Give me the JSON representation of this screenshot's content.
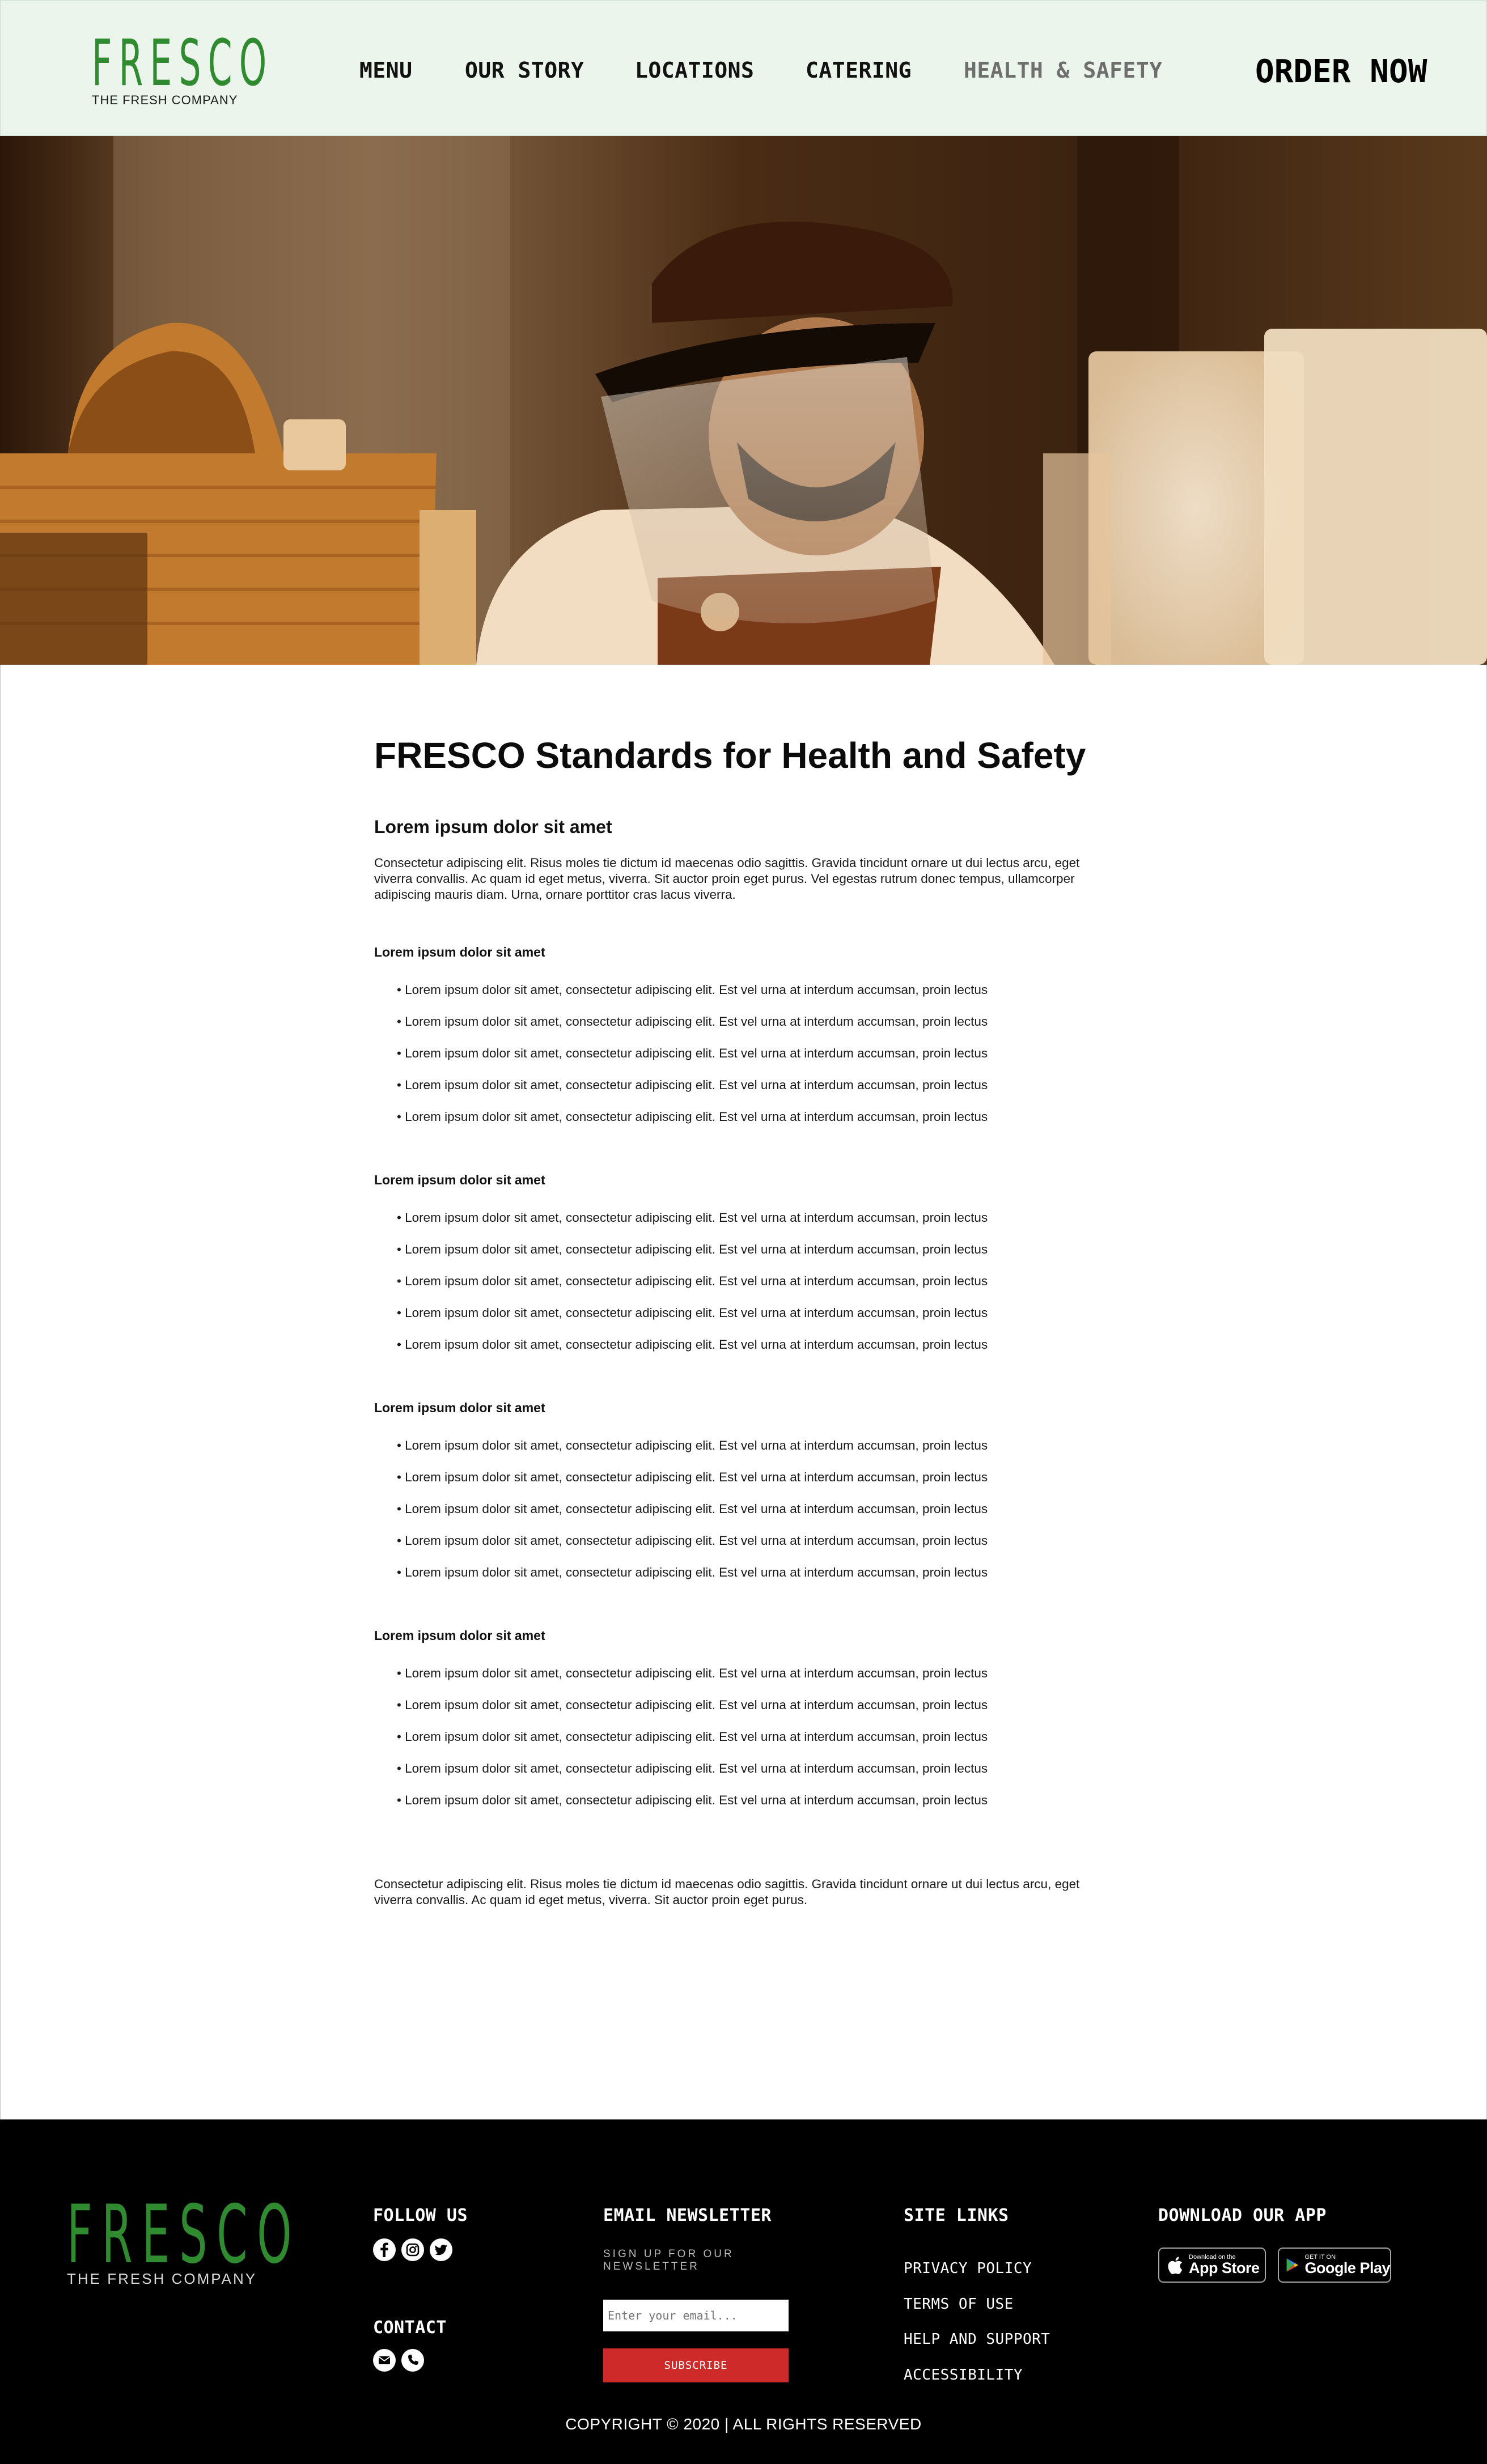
{
  "header": {
    "logo": {
      "name": "FRESCO",
      "tagline": "THE FRESH COMPANY"
    },
    "nav": [
      {
        "label": "MENU"
      },
      {
        "label": "OUR STORY"
      },
      {
        "label": "LOCATIONS"
      },
      {
        "label": "CATERING"
      },
      {
        "label": "HEALTH & SAFETY",
        "active": true
      }
    ],
    "order_label": "ORDER NOW"
  },
  "hero": {
    "icon": "photo-worker-with-face-shield"
  },
  "article": {
    "title": "FRESCO Standards for Health and Safety",
    "lead_heading": "Lorem ipsum dolor sit amet",
    "intro": "Consectetur adipiscing elit. Risus moles tie dictum id maecenas odio sagittis. Gravida tincidunt ornare ut dui lectus arcu, eget viverra convallis. Ac quam id eget metus, viverra. Sit auctor proin eget purus. Vel egestas rutrum donec tempus, ullamcorper adipiscing mauris diam. Urna, ornare porttitor cras lacus viverra.",
    "sections": [
      {
        "heading": "Lorem ipsum dolor sit amet",
        "items": [
          "Lorem ipsum dolor sit amet, consectetur adipiscing elit. Est vel urna at interdum accumsan, proin lectus",
          "Lorem ipsum dolor sit amet, consectetur adipiscing elit. Est vel urna at interdum accumsan, proin lectus",
          "Lorem ipsum dolor sit amet, consectetur adipiscing elit. Est vel urna at interdum accumsan, proin lectus",
          "Lorem ipsum dolor sit amet, consectetur adipiscing elit. Est vel urna at interdum accumsan, proin lectus",
          "Lorem ipsum dolor sit amet, consectetur adipiscing elit. Est vel urna at interdum accumsan, proin lectus"
        ]
      },
      {
        "heading": "Lorem ipsum dolor sit amet",
        "items": [
          "Lorem ipsum dolor sit amet, consectetur adipiscing elit. Est vel urna at interdum accumsan, proin lectus",
          "Lorem ipsum dolor sit amet, consectetur adipiscing elit. Est vel urna at interdum accumsan, proin lectus",
          "Lorem ipsum dolor sit amet, consectetur adipiscing elit. Est vel urna at interdum accumsan, proin lectus",
          "Lorem ipsum dolor sit amet, consectetur adipiscing elit. Est vel urna at interdum accumsan, proin lectus",
          "Lorem ipsum dolor sit amet, consectetur adipiscing elit. Est vel urna at interdum accumsan, proin lectus"
        ]
      },
      {
        "heading": "Lorem ipsum dolor sit amet",
        "items": [
          "Lorem ipsum dolor sit amet, consectetur adipiscing elit. Est vel urna at interdum accumsan, proin lectus",
          "Lorem ipsum dolor sit amet, consectetur adipiscing elit. Est vel urna at interdum accumsan, proin lectus",
          "Lorem ipsum dolor sit amet, consectetur adipiscing elit. Est vel urna at interdum accumsan, proin lectus",
          "Lorem ipsum dolor sit amet, consectetur adipiscing elit. Est vel urna at interdum accumsan, proin lectus",
          "Lorem ipsum dolor sit amet, consectetur adipiscing elit. Est vel urna at interdum accumsan, proin lectus"
        ]
      },
      {
        "heading": "Lorem ipsum dolor sit amet",
        "items": [
          "Lorem ipsum dolor sit amet, consectetur adipiscing elit. Est vel urna at interdum accumsan, proin lectus",
          "Lorem ipsum dolor sit amet, consectetur adipiscing elit. Est vel urna at interdum accumsan, proin lectus",
          "Lorem ipsum dolor sit amet, consectetur adipiscing elit. Est vel urna at interdum accumsan, proin lectus",
          "Lorem ipsum dolor sit amet, consectetur adipiscing elit. Est vel urna at interdum accumsan, proin lectus",
          "Lorem ipsum dolor sit amet, consectetur adipiscing elit. Est vel urna at interdum accumsan, proin lectus"
        ]
      }
    ],
    "closing": "Consectetur adipiscing elit. Risus moles tie dictum id maecenas odio sagittis. Gravida tincidunt ornare ut dui lectus arcu, eget viverra convallis. Ac quam id eget metus, viverra. Sit auctor proin eget purus."
  },
  "footer": {
    "logo": {
      "name": "FRESCO",
      "tagline": "THE FRESH COMPANY"
    },
    "follow_heading": "FOLLOW US",
    "social_icons": [
      "facebook-icon",
      "instagram-icon",
      "twitter-icon"
    ],
    "contact_heading": "CONTACT",
    "contact_icons": [
      "email-icon",
      "phone-icon"
    ],
    "newsletter_heading": "EMAIL NEWSLETTER",
    "newsletter_sub": "SIGN UP FOR OUR NEWSLETTER",
    "email_placeholder": "Enter your email...",
    "subscribe_label": "SUBSCRIBE",
    "site_links_heading": "SITE LINKS",
    "site_links": [
      "PRIVACY POLICY",
      "TERMS OF USE",
      "HELP AND SUPPORT",
      "ACCESSIBILITY"
    ],
    "app_heading": "DOWNLOAD OUR APP",
    "app_store": {
      "small": "Download on the",
      "big": "App Store"
    },
    "google_play": {
      "small": "GET IT ON",
      "big": "Google Play"
    },
    "copyright": "COPYRIGHT © 2020 | ALL RIGHTS RESERVED"
  },
  "colors": {
    "brand_green": "#2f8a30",
    "header_bg": "#ebf5ec",
    "footer_bg": "#000000",
    "subscribe_red": "#cf2a2a",
    "nav_active": "#6e6e6e"
  }
}
